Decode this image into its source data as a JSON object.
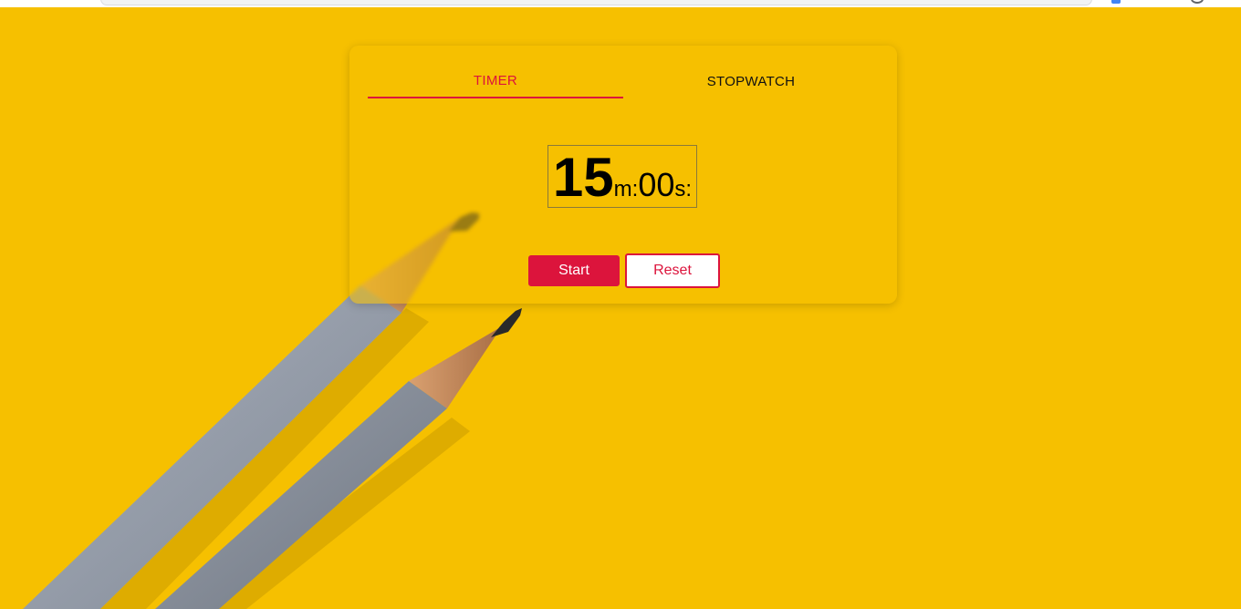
{
  "tabs": {
    "timer_label": "TIMER",
    "stopwatch_label": "STOPWATCH",
    "active": "timer"
  },
  "timer": {
    "minutes": "15",
    "minutes_unit": "m:",
    "seconds": "00",
    "seconds_unit": "s:"
  },
  "buttons": {
    "start_label": "Start",
    "reset_label": "Reset"
  },
  "colors": {
    "background": "#f6c000",
    "accent": "#dc143c"
  },
  "background_image": {
    "subject": "two-pencils"
  }
}
